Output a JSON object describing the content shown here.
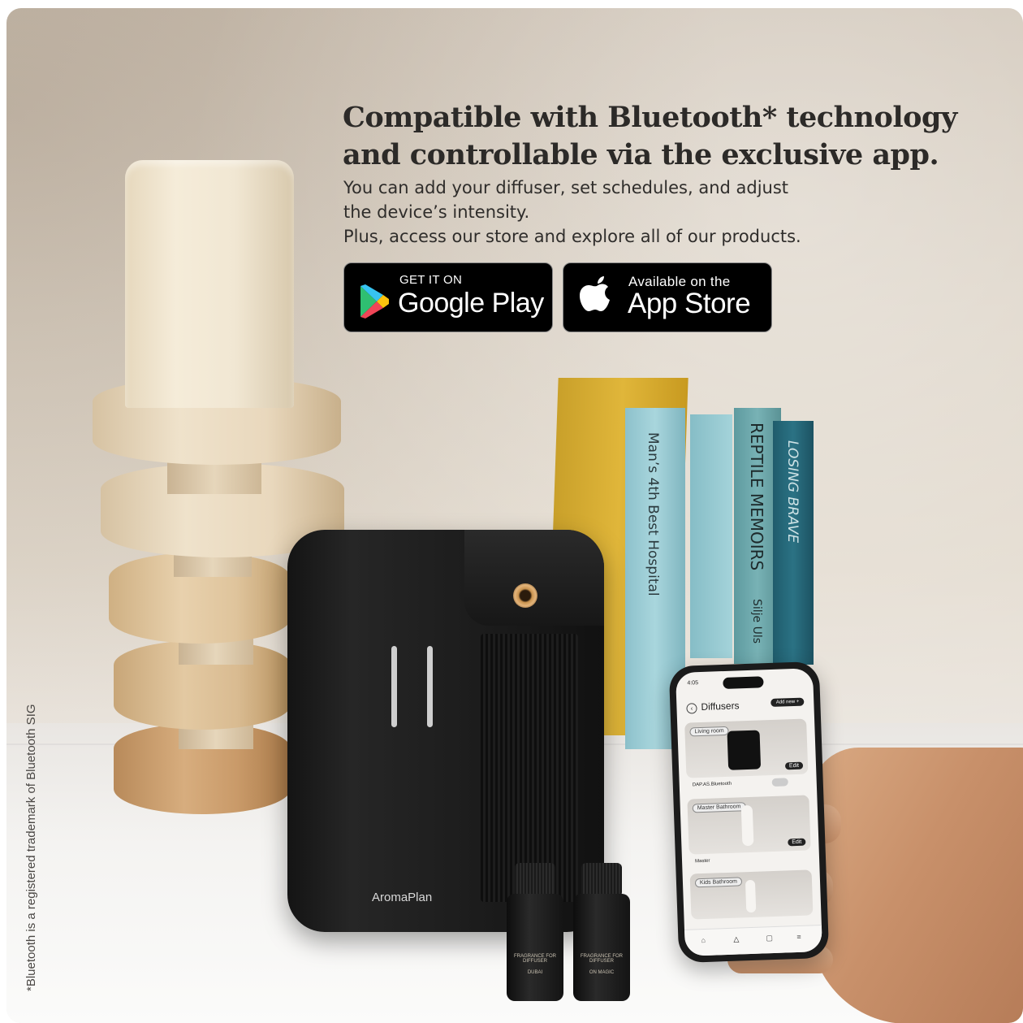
{
  "headline": {
    "line1": "Compatible with Bluetooth* technology",
    "line2": "and controllable via the exclusive app."
  },
  "body": {
    "line1": "You can add your diffuser, set schedules, and adjust",
    "line2": "the device’s intensity.",
    "line3": "Plus, access our store and explore all of our products."
  },
  "google_play": {
    "small": "GET IT ON",
    "big": "Google Play"
  },
  "app_store": {
    "small": "Available on the",
    "big": "App Store"
  },
  "side_note": "*Bluetooth is a registered trademark of Bluetooth SIG",
  "diffuser": {
    "brand": "AromaPlan"
  },
  "books": [
    {
      "title": "Man’s 4th Best Hospital"
    },
    {
      "title": "REPTILE MEMOIRS"
    },
    {
      "title": "Silje Uls"
    },
    {
      "title": "LOSING BRAVE"
    }
  ],
  "bottles": [
    {
      "brand": "FRAGRANCE FOR DIFFUSER",
      "name": "DUBAI"
    },
    {
      "brand": "FRAGRANCE FOR DIFFUSER",
      "name": "ON MAGIC"
    }
  ],
  "phone": {
    "time": "4:05",
    "title": "Diffusers",
    "add_new": "Add new +",
    "cards": [
      {
        "room": "Living room",
        "name": "DAP.AS.Bluetooth",
        "edit": "Edit"
      },
      {
        "room": "Master Bathroom",
        "name": "Master",
        "edit": "Edit"
      },
      {
        "room": "Kids Bathroom"
      }
    ]
  },
  "colors": {
    "button_bg": "#000000",
    "headline": "#2c2a28"
  }
}
